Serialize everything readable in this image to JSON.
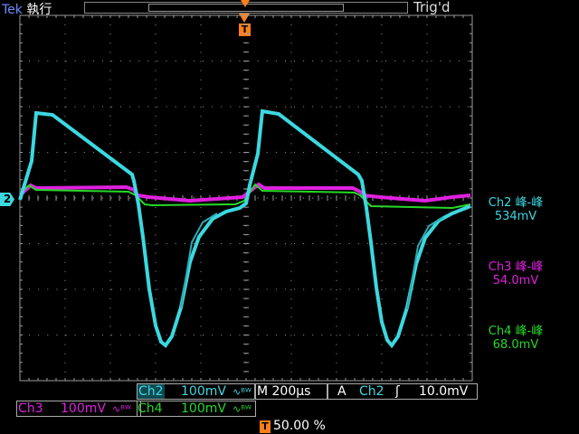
{
  "header": {
    "brand": "Tek",
    "run_state": "執行",
    "trigger_state": "Trig'd",
    "trigger_marker": "T"
  },
  "measurements": [
    {
      "channel": "Ch2",
      "label": "Ch2 峰-峰",
      "value": "534mV",
      "color": "#3cd8e0"
    },
    {
      "channel": "Ch3",
      "label": "Ch3 峰-峰",
      "value": "54.0mV",
      "color": "#e020e0"
    },
    {
      "channel": "Ch4",
      "label": "Ch4 峰-峰",
      "value": "68.0mV",
      "color": "#27d827"
    }
  ],
  "ground_marker": "2",
  "footer": {
    "ch2_name": "Ch2",
    "ch2_scale": "100mV",
    "ch3_name": "Ch3",
    "ch3_scale": "100mV",
    "ch4_name": "Ch4",
    "ch4_scale": "100mV",
    "bw_symbol": "∿ᴮᵂ",
    "timebase": "M 200µs",
    "trig_mode": "A",
    "trig_source": "Ch2",
    "trig_slope": "ʃ",
    "trig_level": "10.0mV",
    "trig_position_marker": "T",
    "trig_position": "50.00 %"
  },
  "colors": {
    "ch2": "#3cd8e0",
    "ch3": "#e020e0",
    "ch4": "#27d827",
    "grid": "#9a9a9a",
    "accent": "#ff7f1a"
  }
}
